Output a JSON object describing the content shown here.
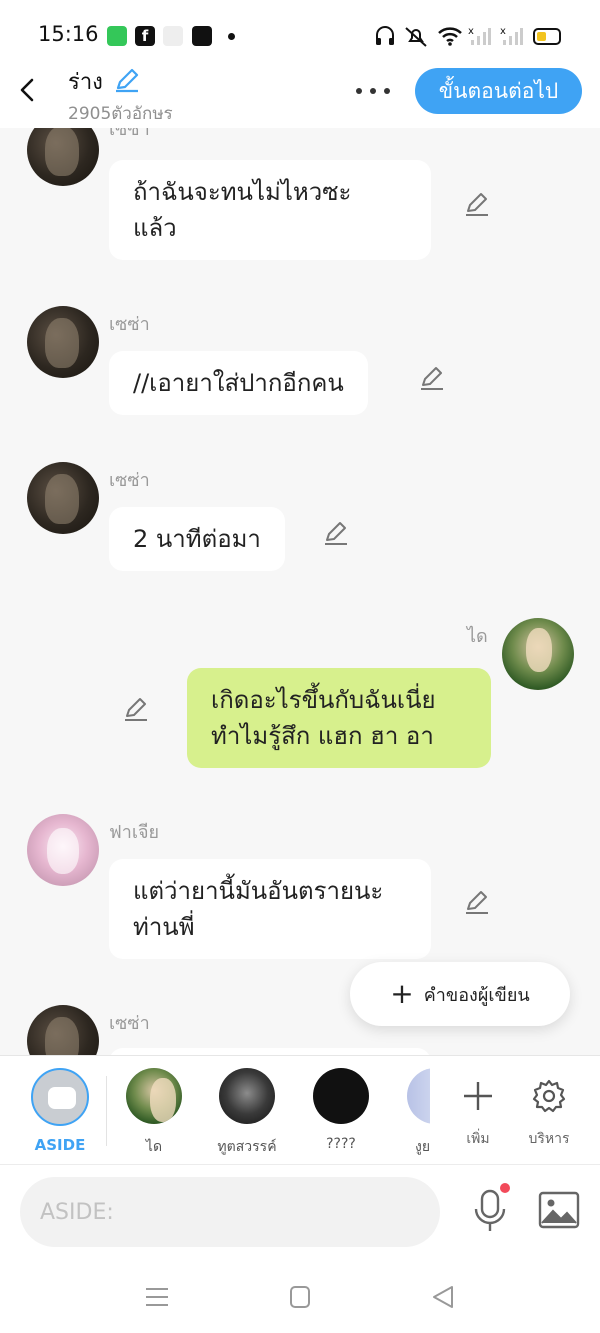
{
  "status_bar": {
    "time": "15:16"
  },
  "header": {
    "title": "ร่าง",
    "char_count": "2905ตัวอักษร",
    "next_label": "ขั้นตอนต่อไป"
  },
  "messages": [
    {
      "sender": "เซซ่า",
      "text_lines": [
        "ถ้าฉันจะทนไม่ไหวซะ",
        "แล้ว"
      ],
      "side": "left"
    },
    {
      "sender": "เซซ่า",
      "text_lines": [
        "//เอายาใส่ปากอีกคน"
      ],
      "side": "left"
    },
    {
      "sender": "เซซ่า",
      "text_lines": [
        "2 นาทีต่อมา"
      ],
      "side": "left"
    },
    {
      "sender": "ได",
      "text_lines": [
        "เกิดอะไรขึ้นกับฉันเนี่ย",
        "ทำไมรู้สึก แฮก ฮา อา"
      ],
      "side": "right"
    },
    {
      "sender": "ฟาเจีย",
      "text_lines": [
        "แต่ว่ายานี้มันอันตรายนะ",
        "ท่านพี่"
      ],
      "side": "left"
    },
    {
      "sender": "เซซ่า",
      "text_lines": [],
      "side": "left"
    }
  ],
  "fab": {
    "label": "คำของผู้เขียน"
  },
  "characters": {
    "aside": "ASIDE",
    "list": [
      "ได",
      "ทูตสวรรค์",
      "????",
      "งูย"
    ],
    "add_label": "เพิ่ม",
    "manage_label": "บริหาร"
  },
  "input": {
    "placeholder": "ASIDE:"
  },
  "colors": {
    "accent": "#3fa3f4",
    "green_bubble": "#d7f08d",
    "background": "#f7f7f7",
    "notification_dot": "#f24a5a"
  }
}
